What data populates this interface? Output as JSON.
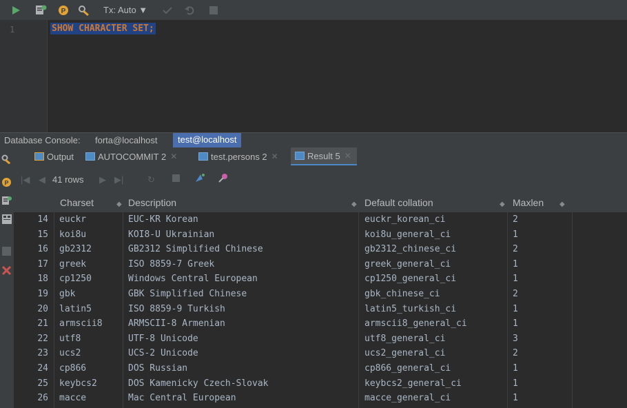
{
  "toolbar": {
    "tx_label": "Tx: Auto ▼",
    "icons": [
      "run-icon",
      "datasource-icon",
      "parameters-icon",
      "settings-icon",
      "commit-icon",
      "rollback-icon",
      "stop-icon"
    ]
  },
  "editor": {
    "line_number": "1",
    "code": "SHOW CHARACTER SET;"
  },
  "console": {
    "label": "Database Console:",
    "tabs": [
      "forta@localhost",
      "test@localhost"
    ],
    "active_tab": "test@localhost"
  },
  "result_tabs": [
    {
      "label": "Output"
    },
    {
      "label": "AUTOCOMMIT 2"
    },
    {
      "label": "test.persons 2"
    },
    {
      "label": "Result 5"
    }
  ],
  "nav": {
    "row_count": "41 rows"
  },
  "table": {
    "headers": [
      "Charset",
      "Description",
      "Default collation",
      "Maxlen"
    ],
    "rows": [
      {
        "n": "14",
        "charset": "euckr",
        "desc": "EUC-KR Korean",
        "coll": "euckr_korean_ci",
        "max": "2"
      },
      {
        "n": "15",
        "charset": "koi8u",
        "desc": "KOI8-U Ukrainian",
        "coll": "koi8u_general_ci",
        "max": "1"
      },
      {
        "n": "16",
        "charset": "gb2312",
        "desc": "GB2312 Simplified Chinese",
        "coll": "gb2312_chinese_ci",
        "max": "2"
      },
      {
        "n": "17",
        "charset": "greek",
        "desc": "ISO 8859-7 Greek",
        "coll": "greek_general_ci",
        "max": "1"
      },
      {
        "n": "18",
        "charset": "cp1250",
        "desc": "Windows Central European",
        "coll": "cp1250_general_ci",
        "max": "1"
      },
      {
        "n": "19",
        "charset": "gbk",
        "desc": "GBK Simplified Chinese",
        "coll": "gbk_chinese_ci",
        "max": "2"
      },
      {
        "n": "20",
        "charset": "latin5",
        "desc": "ISO 8859-9 Turkish",
        "coll": "latin5_turkish_ci",
        "max": "1"
      },
      {
        "n": "21",
        "charset": "armscii8",
        "desc": "ARMSCII-8 Armenian",
        "coll": "armscii8_general_ci",
        "max": "1"
      },
      {
        "n": "22",
        "charset": "utf8",
        "desc": "UTF-8 Unicode",
        "coll": "utf8_general_ci",
        "max": "3"
      },
      {
        "n": "23",
        "charset": "ucs2",
        "desc": "UCS-2 Unicode",
        "coll": "ucs2_general_ci",
        "max": "2"
      },
      {
        "n": "24",
        "charset": "cp866",
        "desc": "DOS Russian",
        "coll": "cp866_general_ci",
        "max": "1"
      },
      {
        "n": "25",
        "charset": "keybcs2",
        "desc": "DOS Kamenicky Czech-Slovak",
        "coll": "keybcs2_general_ci",
        "max": "1"
      },
      {
        "n": "26",
        "charset": "macce",
        "desc": "Mac Central European",
        "coll": "macce_general_ci",
        "max": "1"
      }
    ]
  },
  "colors": {
    "keyword": "#cc7832",
    "selection": "#214283",
    "active_tab": "#4b6eaf",
    "text": "#a9b7c6"
  }
}
